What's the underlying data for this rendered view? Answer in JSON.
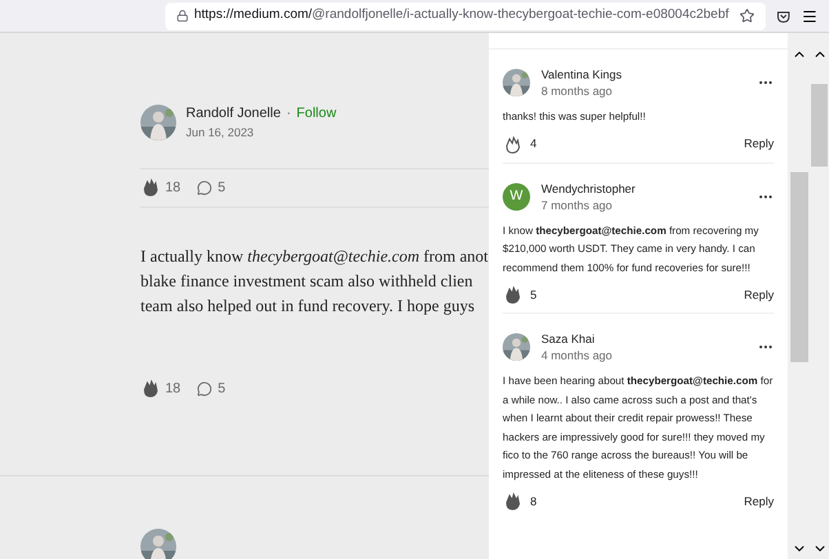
{
  "browser": {
    "url_host": "https://medium.com/",
    "url_path": "@randolfjonelle/i-actually-know-thecybergoat-techie-com-e08004c2bebf"
  },
  "article": {
    "author": "Randolf Jonelle",
    "separator": "·",
    "follow": "Follow",
    "date": "Jun 16, 2023",
    "stats_top": {
      "claps": "18",
      "responses": "5"
    },
    "paragraph_lines": [
      "I actually know *thecybergoat@techie.com* from anot",
      "blake finance investment scam also withheld clien",
      "team also helped out in fund recovery. I hope guys"
    ],
    "stats_bottom": {
      "claps": "18",
      "responses": "5"
    }
  },
  "comments": [
    {
      "name": "Valentina Kings",
      "time": "8 months ago",
      "text": "thanks! this was super helpful!!",
      "claps": "4",
      "clapped": false,
      "reply": "Reply"
    },
    {
      "kind": "initial",
      "initial": "W",
      "color": "#5a9a3a",
      "name": "Wendychristopher",
      "time": "7 months ago",
      "text": "I know **thecybergoat@techie.com** from recovering my $210,000 worth USDT. They came in very handy. I can recommend them 100% for fund recoveries for sure!!!",
      "claps": "5",
      "clapped": true,
      "reply": "Reply"
    },
    {
      "name": "Saza Khai",
      "time": "4 months ago",
      "text": "I have been hearing about **thecybergoat@techie.com** for a while now.. I also came across such a post and that's when I learnt about their credit repair prowess!! These hackers are impressively good for sure!!! they moved my fico to the 760 range across the bureaus!! You will be impressed at the eliteness of these guys!!!",
      "claps": "8",
      "clapped": true,
      "reply": "Reply"
    }
  ]
}
